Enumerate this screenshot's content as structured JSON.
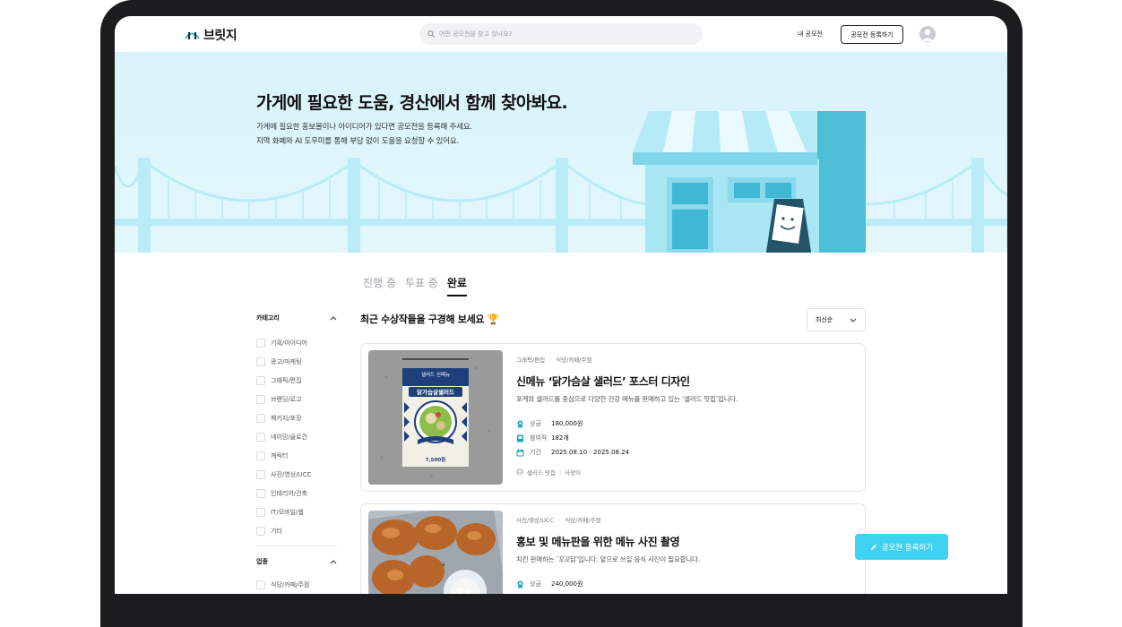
{
  "header": {
    "logo_text": "브릿지",
    "search_placeholder": "어떤 공모전을 찾고 있나요?",
    "my_contests": "내 공모전",
    "register_button": "공모전 등록하기"
  },
  "hero": {
    "title": "가게에 필요한 도움, 경산에서 함께 찾아봐요.",
    "subtitle_line1": "가게에 필요한 홍보물이나 아이디어가 있다면 공모전을 등록해 주세요.",
    "subtitle_line2": "지역 화폐와 AI 도우미를 통해 부담 없이 도움을 요청할 수 있어요."
  },
  "tabs": [
    {
      "label": "진행 중",
      "active": false
    },
    {
      "label": "투표 중",
      "active": false
    },
    {
      "label": "완료",
      "active": true
    }
  ],
  "sidebar": {
    "category_title": "카테고리",
    "categories": [
      "기획/아이디어",
      "광고/마케팅",
      "그래픽/편집",
      "브랜딩/로고",
      "패키지/포장",
      "네이밍/슬로건",
      "캐릭터",
      "사진/영상/UCC",
      "인테리어/건축",
      "IT/모바일/웹",
      "기타"
    ],
    "industry_title": "업종",
    "industries": [
      "식당/카페/주점"
    ]
  },
  "main": {
    "section_title": "최근 수상작들을 구경해 보세요 🏆",
    "sort_label": "최신순",
    "cards": [
      {
        "tags": [
          "그래픽/편집",
          "식당/카페/주점"
        ],
        "title": "신메뉴 ‘닭가슴살 샐러드’ 포스터 디자인",
        "description": "포케와 샐러드를 중심으로 다양한 건강 메뉴를 판매하고 있는 ‘샐러드 맛집’입니다.",
        "prize_label": "상금",
        "prize_value": "180,000원",
        "participants_label": "참여작",
        "participants_value": "182개",
        "period_label": "기간",
        "period_value": "2025.08.10 - 2025.08.24",
        "shop_name": "샐러드 맛집",
        "owner": "사장이",
        "poster_top": "샐러드 신메뉴",
        "poster_title": "닭가슴살샐러드",
        "poster_price": "7,500원"
      },
      {
        "tags": [
          "사진/영상/UCC",
          "식당/카페/주점"
        ],
        "title": "홍보 및 메뉴판을 위한 메뉴 사진 촬영",
        "description": "치킨 판매하는 ‘꼬꼬닭’입니다. 앞으로 쓰일 음식 사진이 필요합니다.",
        "prize_label": "상금",
        "prize_value": "240,000원"
      }
    ]
  },
  "floating_button": "공모전 등록하기",
  "colors": {
    "accent": "#3fd2f2",
    "hero_bg": "#d8f3fb",
    "store": "#6cd0e6"
  }
}
